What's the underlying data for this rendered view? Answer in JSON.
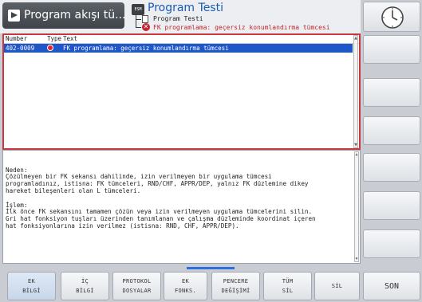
{
  "header": {
    "mode_title": "Program akışı tü...",
    "program_icon_text": "ESM",
    "program_title": "Program Testi",
    "tree_item": "Program Testi",
    "tree_error": "FK programlama: geçersiz konumlandırma tümcesi"
  },
  "error_list": {
    "columns": {
      "number": "Number",
      "type": "Type",
      "text": "Text"
    },
    "row": {
      "number": "402-0009",
      "text": "FK programlama: geçersiz konumlandırma tümcesi"
    }
  },
  "help_text": "Neden:\nÇözülmeyen bir FK sekansı dahilinde, izin verilmeyen bir uygulama tümcesi\nprogramladınız, istisna: FK tümceleri, RND/CHF, APPR/DEP, yalnız FK düzlemine dikey\nhareket bileşenleri olan L tümceleri.\n\nİşlem:\nİlk önce FK sekansını tamamen çözün veya izin verilmeyen uygulama tümcelerini silin.\nGri hat fonksiyon tuşları üzerinden tanımlanan ve çalışma düzleminde koordinat içeren\nhat fonksiyonlarına izin verilmez (istisna: RND, CHF, APPR/DEP).",
  "softkeys": [
    {
      "line1": "EK",
      "line2": "BİLGİ"
    },
    {
      "line1": "İÇ",
      "line2": "BİLGİ"
    },
    {
      "line1": "PROTOKOL",
      "line2": "DOSYALAR"
    },
    {
      "line1": "EK",
      "line2": "FONKS."
    },
    {
      "line1": "PENCERE",
      "line2": "DEĞİŞİMİ"
    },
    {
      "line1": "TÜM",
      "line2": "SİL"
    },
    {
      "line1": "SİL",
      "line2": ""
    }
  ],
  "son_button": "SON",
  "colors": {
    "selection": "#1f56c8",
    "error_red": "#c9383e",
    "header_blue": "#1a5bb3"
  },
  "icons": [
    "arrow-right-icon",
    "clock-icon",
    "error-icon",
    "document-icon"
  ]
}
